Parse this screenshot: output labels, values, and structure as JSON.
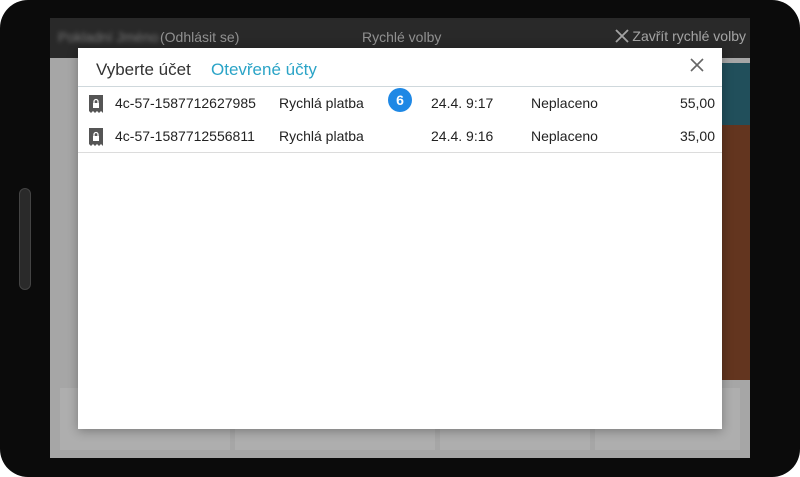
{
  "topbar": {
    "user_name": "Pokladní Jméno",
    "logout_label": "(Odhlásit se)",
    "title": "Rychlé volby",
    "close_label": "Zavřít rychlé volby"
  },
  "modal": {
    "title": "Vyberte účet",
    "subtitle": "Otevřené účty",
    "close_icon": "close-icon"
  },
  "accounts": [
    {
      "id": "4c-57-1587712627985",
      "type": "Rychlá platba",
      "date": "24.4. 9:17",
      "status": "Neplaceno",
      "amount": "55,00"
    },
    {
      "id": "4c-57-1587712556811",
      "type": "Rychlá platba",
      "date": "24.4. 9:16",
      "status": "Neplaceno",
      "amount": "35,00"
    }
  ],
  "badge": {
    "value": "6",
    "color": "#1e88e5"
  },
  "colors": {
    "accent": "#2ba4c7",
    "teal_tile": "#2f6e7e",
    "brown_tile": "#8a4a2c"
  }
}
